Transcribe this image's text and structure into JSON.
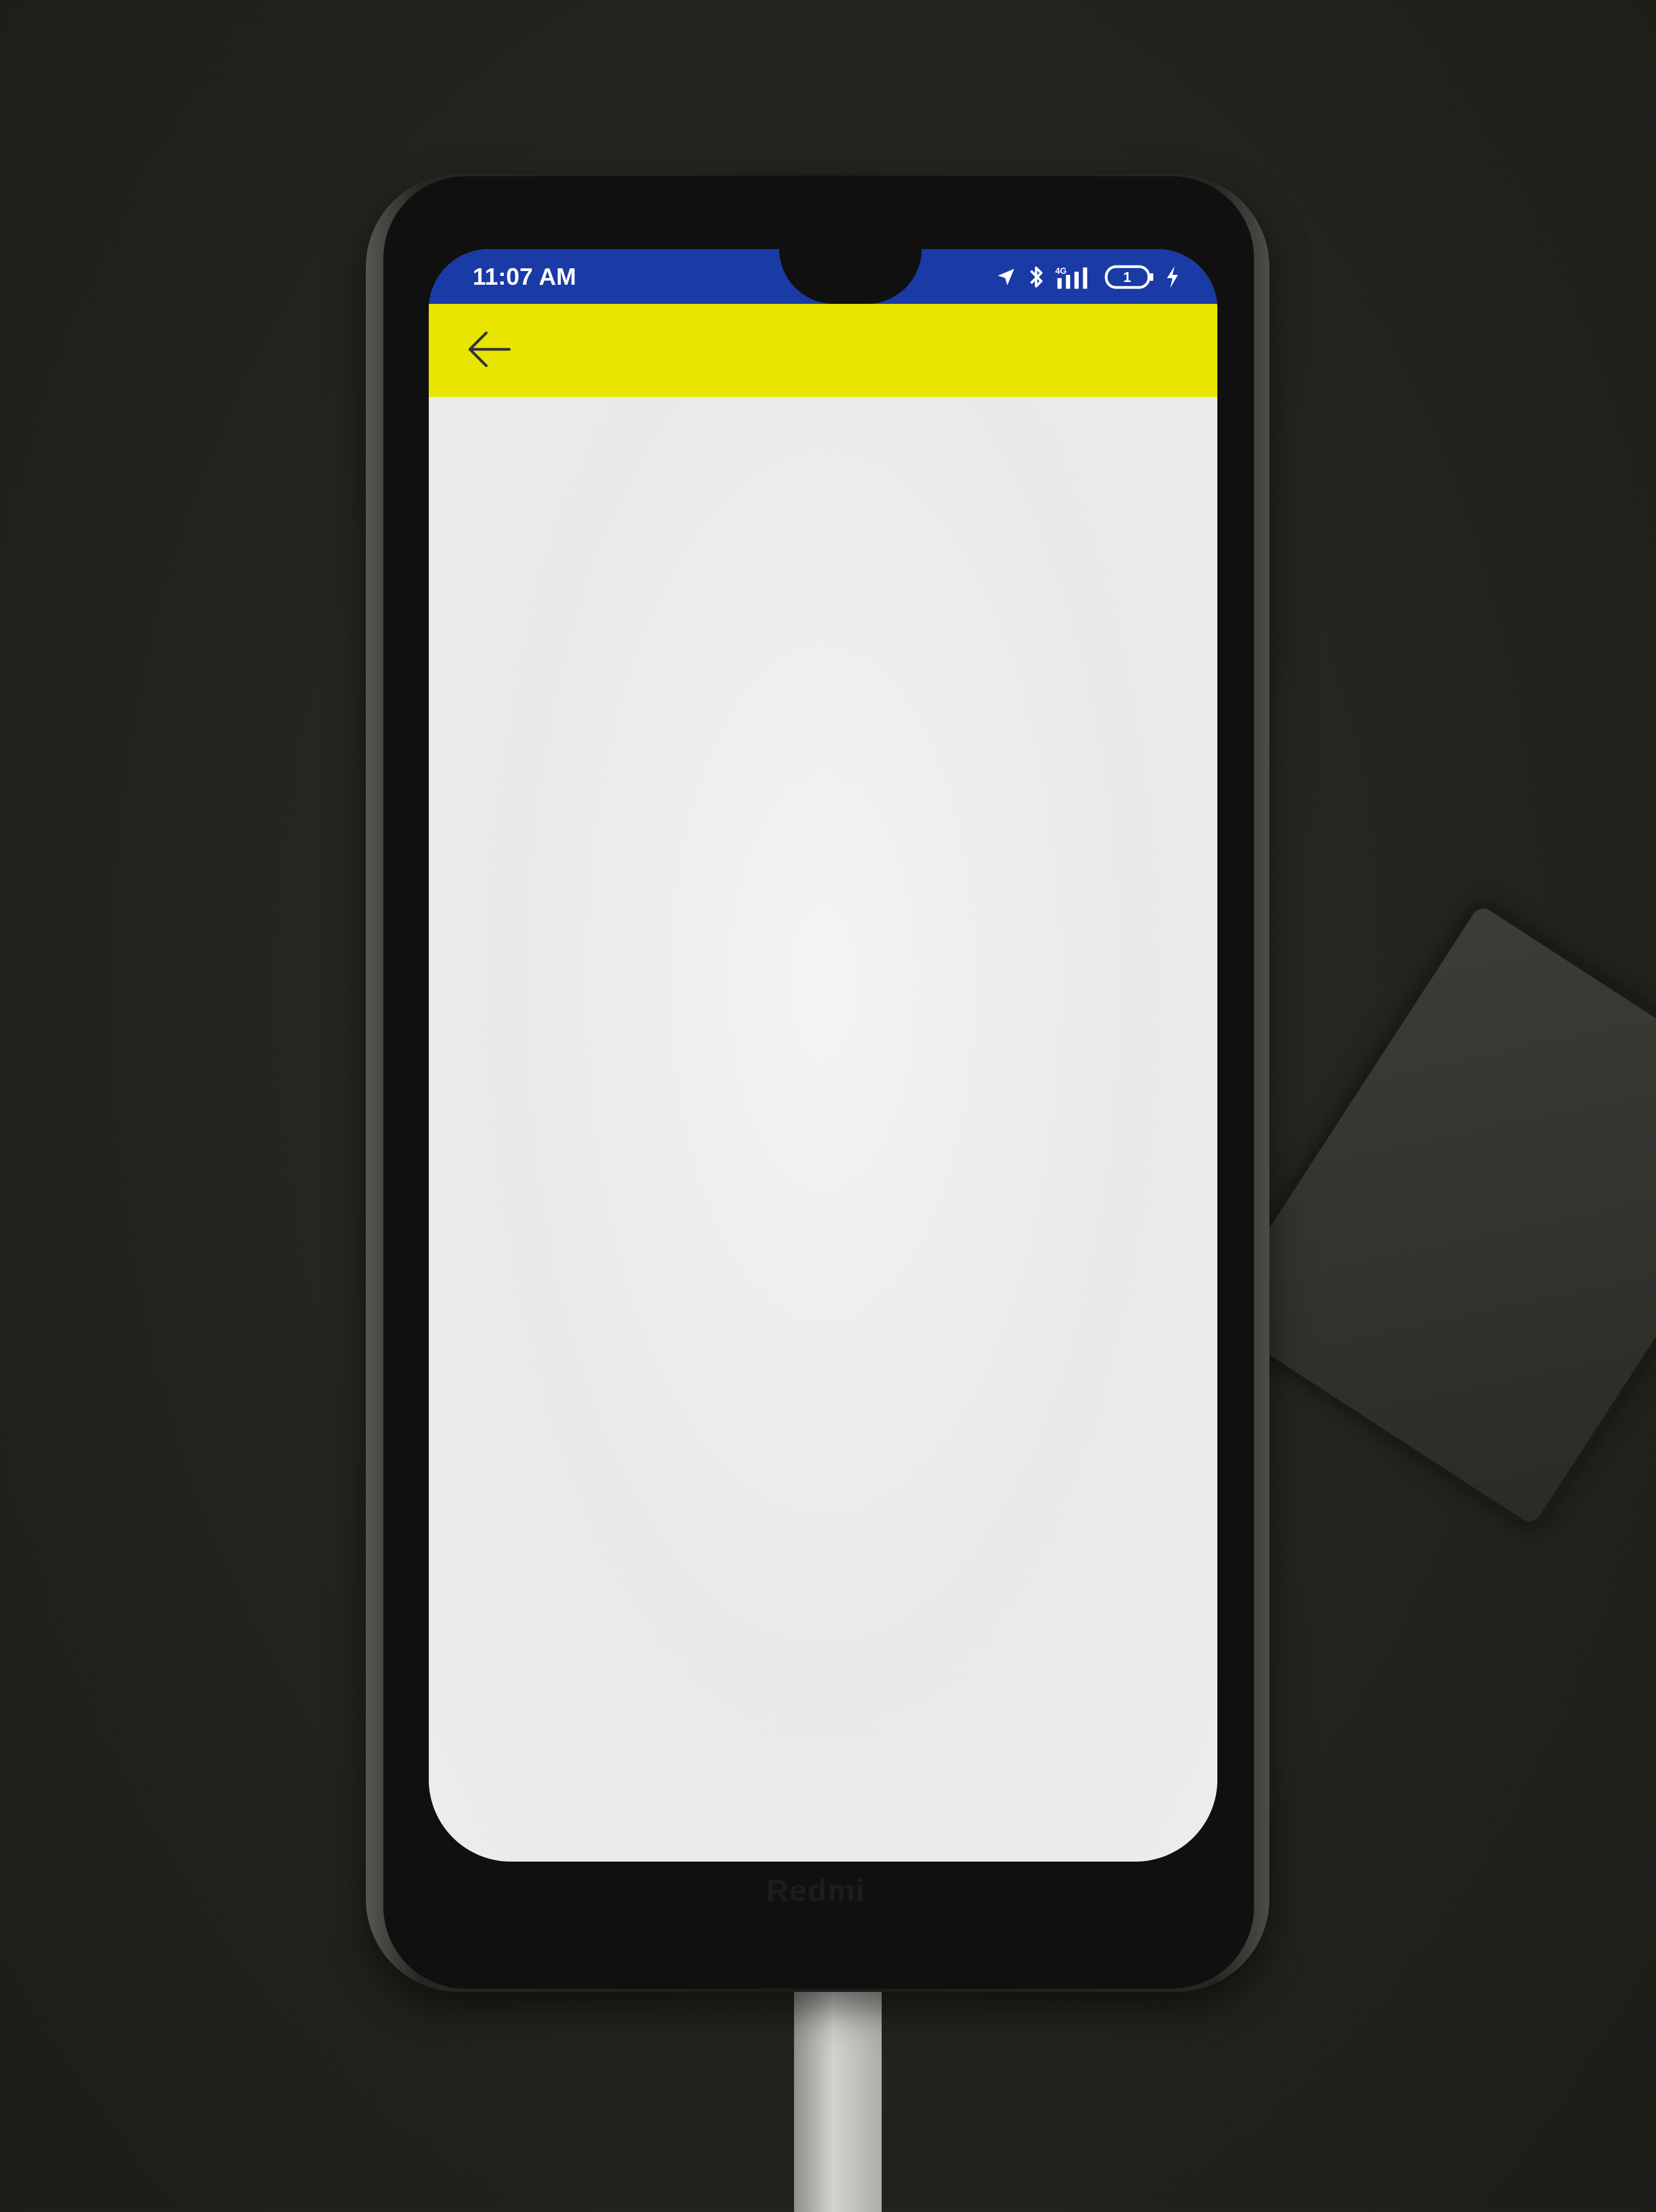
{
  "status_bar": {
    "time": "11:07 AM",
    "battery_level": "1",
    "background_color": "#1a3aa6",
    "icons": [
      "location-icon",
      "bluetooth-icon",
      "signal-icon",
      "battery-icon",
      "charging-icon"
    ]
  },
  "app_bar": {
    "background_color": "#eae500",
    "back_icon": "arrow-left-icon"
  },
  "content": {
    "background_color": "#ededeb"
  },
  "device": {
    "brand": "Redmi"
  }
}
